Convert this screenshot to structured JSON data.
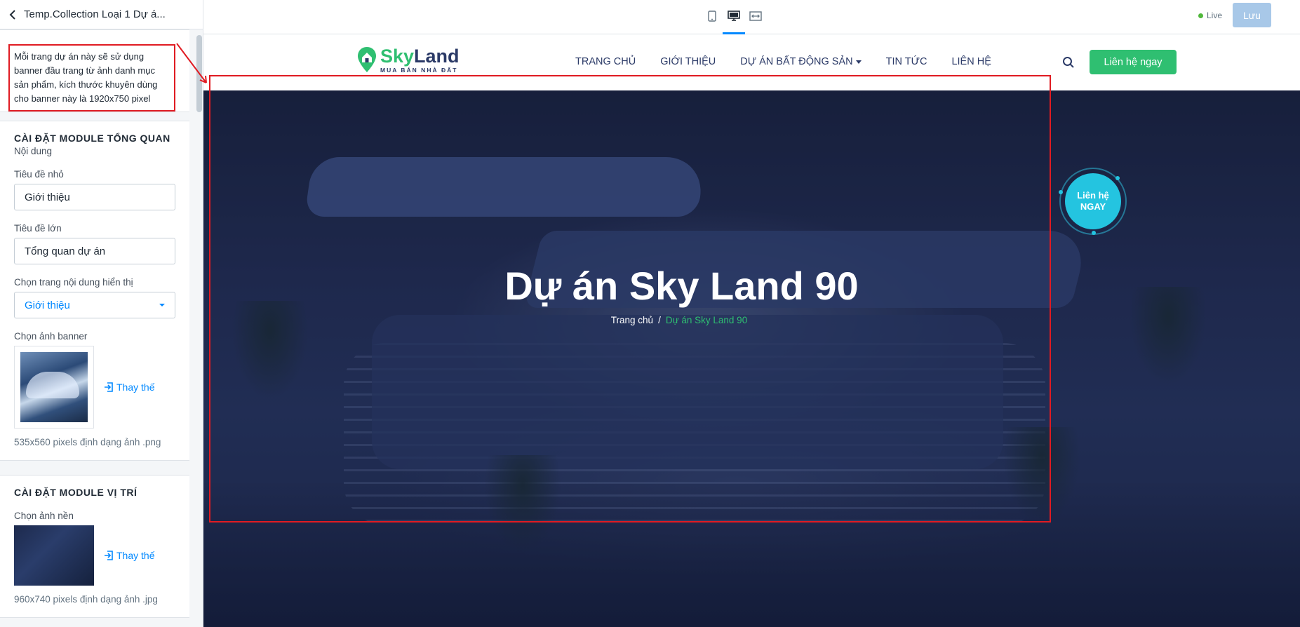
{
  "sidebar": {
    "title": "Temp.Collection Loại 1 Dự á...",
    "note": "Mỗi trang dự án này sẽ sử dụng banner đầu trang từ ảnh danh mục sản phẩm, kích thước khuyên dùng cho banner này là 1920x750 pixel",
    "overview": {
      "title": "CÀI ĐẶT MODULE TỔNG QUAN",
      "subtitle": "Nội dung",
      "small_title_label": "Tiêu đề nhỏ",
      "small_title_value": "Giới thiệu",
      "big_title_label": "Tiêu đề lớn",
      "big_title_value": "Tổng quan dự án",
      "page_select_label": "Chọn trang nội dung hiển thị",
      "page_select_value": "Giới thiệu",
      "banner_label": "Chọn ảnh banner",
      "replace_label": "Thay thế",
      "banner_hint": "535x560 pixels định dạng ảnh .png"
    },
    "location": {
      "title": "CÀI ĐẶT MODULE VỊ TRÍ",
      "bg_label": "Chọn ảnh nền",
      "replace_label": "Thay thế",
      "bg_hint": "960x740 pixels định dạng ảnh .jpg"
    }
  },
  "toolbar": {
    "live_label": "Live",
    "save_label": "Lưu",
    "accent": "#0088ff"
  },
  "site": {
    "logo_sky": "Sky",
    "logo_land": "Land",
    "logo_tag": "MUA BÁN NHÀ ĐẤT",
    "nav": [
      "TRANG CHỦ",
      "GIỚI THIỆU",
      "DỰ ÁN BẤT ĐỘNG SẢN",
      "TIN TỨC",
      "LIÊN HỆ"
    ],
    "contact_button": "Liên hệ ngay",
    "brand_green": "#2fbf71",
    "brand_navy": "#2b3a67"
  },
  "banner": {
    "title": "Dự án Sky Land 90",
    "breadcrumb_home": "Trang chủ",
    "breadcrumb_sep": "/",
    "breadcrumb_current": "Dự án Sky Land 90",
    "float_line1": "Liên hệ",
    "float_line2": "NGAY",
    "float_color": "#24c4e0"
  },
  "annotation_color": "#e01b22"
}
